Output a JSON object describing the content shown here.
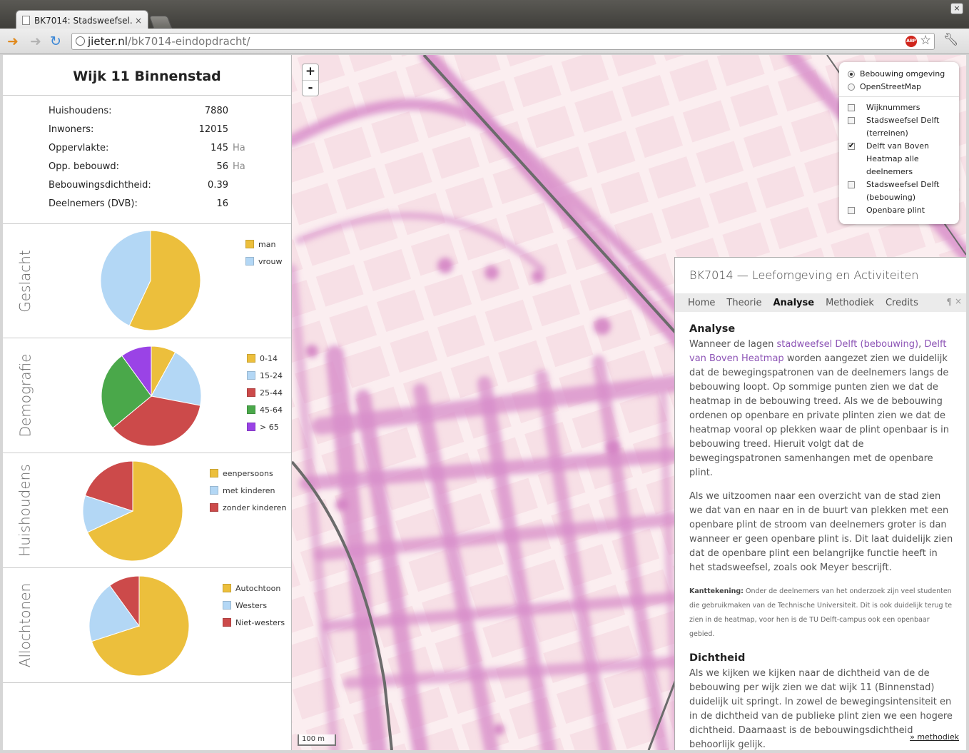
{
  "browser": {
    "tab_title": "BK7014: Stadsweefsel.",
    "tab_close": "×",
    "url_domain": "jieter.nl",
    "url_path": "/bk7014-eindopdracht/",
    "window_close": "×",
    "abp_label": "ABP"
  },
  "sidebar": {
    "title": "Wijk 11 Binnenstad",
    "stats": [
      {
        "label": "Huishoudens:",
        "value": "7880",
        "unit": ""
      },
      {
        "label": "Inwoners:",
        "value": "12015",
        "unit": ""
      },
      {
        "label": "Oppervlakte:",
        "value": "145",
        "unit": "Ha"
      },
      {
        "label": "Opp. bebouwd:",
        "value": "56",
        "unit": "Ha"
      },
      {
        "label": "Bebouwingsdichtheid:",
        "value": "0.39",
        "unit": ""
      },
      {
        "label": "Deelnemers (DVB):",
        "value": "16",
        "unit": ""
      }
    ]
  },
  "chart_data": [
    {
      "type": "pie",
      "title": "Geslacht",
      "categories": [
        "man",
        "vrouw"
      ],
      "values": [
        57,
        43
      ],
      "colors": [
        "#ecbf3c",
        "#b3d7f5"
      ]
    },
    {
      "type": "pie",
      "title": "Demografie",
      "categories": [
        "0-14",
        "15-24",
        "25-44",
        "45-64",
        "> 65"
      ],
      "values": [
        8,
        20,
        36,
        26,
        10
      ],
      "colors": [
        "#ecbf3c",
        "#b3d7f5",
        "#cc4a4a",
        "#4aa84a",
        "#9a43e6"
      ]
    },
    {
      "type": "pie",
      "title": "Huishoudens",
      "categories": [
        "eenpersoons",
        "met kinderen",
        "zonder kinderen"
      ],
      "values": [
        68,
        12,
        20
      ],
      "colors": [
        "#ecbf3c",
        "#b3d7f5",
        "#cc4a4a"
      ]
    },
    {
      "type": "pie",
      "title": "Allochtonen",
      "categories": [
        "Autochtoon",
        "Westers",
        "Niet-westers"
      ],
      "values": [
        70,
        20,
        10
      ],
      "colors": [
        "#ecbf3c",
        "#b3d7f5",
        "#cc4a4a"
      ]
    }
  ],
  "map": {
    "zoom_in": "+",
    "zoom_out": "-",
    "scale": "100 m",
    "base_layers": [
      {
        "label": "Bebouwing omgeving",
        "selected": true
      },
      {
        "label": "OpenStreetMap",
        "selected": false
      }
    ],
    "overlays": [
      {
        "label": "Wijknummers",
        "checked": false
      },
      {
        "label": "Stadsweefsel Delft (terreinen)",
        "checked": false
      },
      {
        "label": "Delft van Boven Heatmap alle deelnemers",
        "checked": true
      },
      {
        "label": "Stadsweefsel Delft (bebouwing)",
        "checked": false
      },
      {
        "label": "Openbare plint",
        "checked": false
      }
    ]
  },
  "info": {
    "title": "BK7014 — Leefomgeving en Activiteiten",
    "nav": [
      "Home",
      "Theorie",
      "Analyse",
      "Methodiek",
      "Credits"
    ],
    "active_nav": "Analyse",
    "pilcrow": "¶",
    "close": "×",
    "analyse_heading": "Analyse",
    "p1_pre": "Wanneer de lagen ",
    "p1_link1": "stadweefsel Delft (bebouwing)",
    "p1_sep": ", ",
    "p1_link2": "Delft van Boven Heatmap",
    "p1_post": " worden aangezet zien we duidelijk dat de bewegingspatronen van de deelnemers langs de bebouwing loopt. Op sommige punten zien we dat de heatmap in de bebouwing treed. Als we de bebouwing ordenen op openbare en private plinten zien we dat de heatmap vooral op plekken waar de plint openbaar is in bebouwing treed. Hieruit volgt dat de bewegingspatronen samenhangen met de openbare plint.",
    "p2": "Als we uitzoomen naar een overzicht van de stad zien we dat van en naar en in de buurt van plekken met een openbare plint de stroom van deelnemers groter is dan wanneer er geen openbare plint is. Dit laat duidelijk zien dat de openbare plint een belangrijke functie heeft in het stadsweefsel, zoals ook Meyer bescrijft.",
    "note_label": "Kanttekening:",
    "note_text": " Onder de deelnemers van het onderzoek zijn veel studenten die gebruikmaken van de Technische Universiteit. Dit is ook duidelijk terug te zien in de heatmap, voor hen is de TU Delft-campus ook een openbaar gebied.",
    "dichtheid_heading": "Dichtheid",
    "p3": "Als we kijken we kijken naar de dichtheid van de de bebouwing per wijk zien we dat wijk 11 (Binnenstad) duidelijk uit springt. In zowel de bewegingsintensiteit en in de dichtheid van de publieke plint zien we een hogere dichtheid. Daarnaast is de bebouwingsdichtheid behoorlijk gelijk.",
    "more_link": "» methodiek"
  },
  "icons": {
    "back": "back-arrow-icon",
    "forward": "forward-arrow-icon",
    "reload": "reload-icon",
    "star": "bookmark-star-icon",
    "wrench": "wrench-icon"
  }
}
